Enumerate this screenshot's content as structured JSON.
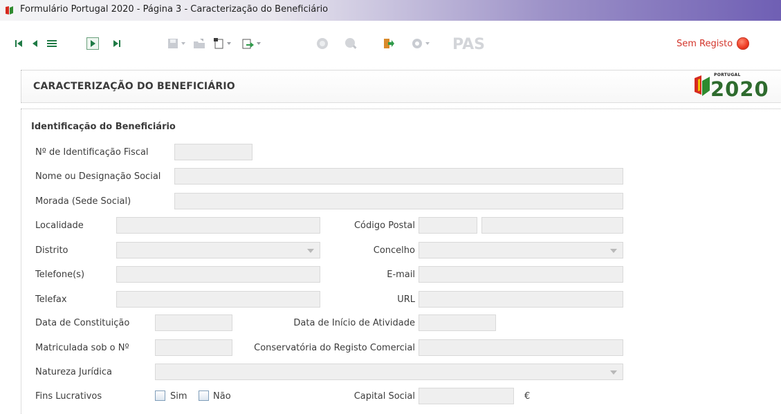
{
  "window": {
    "title": "Formulário Portugal 2020 - Página 3 - Caracterização do Beneficiário"
  },
  "toolbar": {
    "status_label": "Sem Registo",
    "icons": [
      "first-page-icon",
      "previous-page-icon",
      "menu-icon",
      "next-page-icon",
      "last-page-icon",
      "save-icon",
      "open-folder-icon",
      "new-document-icon",
      "export-icon",
      "validate-icon",
      "search-icon",
      "exit-icon",
      "settings-icon",
      "pas-icon"
    ]
  },
  "header": {
    "title": "CARACTERIZAÇÃO DO BENEFICIÁRIO",
    "logo_top": "PORTUGAL",
    "logo_year": "2020"
  },
  "form": {
    "section_title": "Identificação do Beneficiário",
    "nif_label": "Nº de Identificação Fiscal",
    "nome_label": "Nome ou Designação Social",
    "morada_label": "Morada (Sede Social)",
    "localidade_label": "Localidade",
    "codigo_postal_label": "Código Postal",
    "distrito_label": "Distrito",
    "concelho_label": "Concelho",
    "telefone_label": "Telefone(s)",
    "email_label": "E-mail",
    "telefax_label": "Telefax",
    "url_label": "URL",
    "data_constituicao_label": "Data de Constituição",
    "data_inicio_label": "Data de Início de Atividade",
    "matricula_label": "Matriculada sob o Nº",
    "conservatoria_label": "Conservatória do Registo Comercial",
    "natureza_label": "Natureza Jurídica",
    "fins_lucrativos_label": "Fins Lucrativos",
    "sim_label": "Sim",
    "nao_label": "Não",
    "capital_social_label": "Capital Social",
    "currency_symbol": "€"
  },
  "colors": {
    "accent_red": "#d3352b",
    "field_bg": "#efefef",
    "logo_green": "#2e6b2e"
  }
}
